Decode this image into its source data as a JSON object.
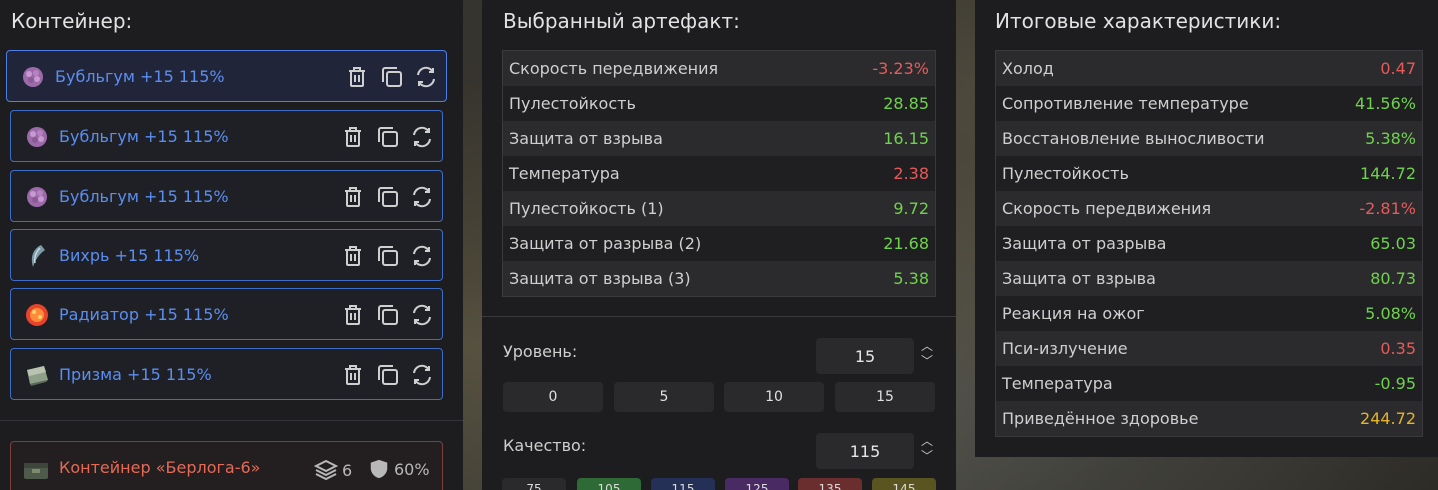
{
  "left": {
    "title": "Контейнер:",
    "items": [
      {
        "name": "Бубльгум +15 115%",
        "icon": "bubblegum-artifact-icon"
      },
      {
        "name": "Бубльгум +15 115%",
        "icon": "bubblegum-artifact-icon"
      },
      {
        "name": "Бубльгум +15 115%",
        "icon": "bubblegum-artifact-icon"
      },
      {
        "name": "Вихрь +15 115%",
        "icon": "vortex-artifact-icon"
      },
      {
        "name": "Радиатор +15 115%",
        "icon": "radiator-artifact-icon"
      },
      {
        "name": "Призма +15 115%",
        "icon": "prism-artifact-icon"
      }
    ],
    "container": {
      "name": "Контейнер «Берлога-6»",
      "slots": "6",
      "protection": "60%"
    }
  },
  "middle": {
    "title": "Выбранный артефакт:",
    "stats": [
      {
        "label": "Скорость передвижения",
        "value": "-3.23%",
        "tone": "neg"
      },
      {
        "label": "Пулестойкость",
        "value": "28.85",
        "tone": "pos"
      },
      {
        "label": "Защита от взрыва",
        "value": "16.15",
        "tone": "pos"
      },
      {
        "label": "Температура",
        "value": "2.38",
        "tone": "neg"
      },
      {
        "label": "Пулестойкость (1)",
        "value": "9.72",
        "tone": "pos"
      },
      {
        "label": "Защита от разрыва (2)",
        "value": "21.68",
        "tone": "pos"
      },
      {
        "label": "Защита от взрыва (3)",
        "value": "5.38",
        "tone": "pos"
      }
    ],
    "level": {
      "label": "Уровень:",
      "value": "15",
      "presets": [
        "0",
        "5",
        "10",
        "15"
      ]
    },
    "quality": {
      "label": "Качество:",
      "value": "115",
      "presets": [
        "75",
        "105",
        "115",
        "125",
        "135",
        "145"
      ]
    }
  },
  "right": {
    "title": "Итоговые характеристики:",
    "stats": [
      {
        "label": "Холод",
        "value": "0.47",
        "tone": "neg"
      },
      {
        "label": "Сопротивление температуре",
        "value": "41.56%",
        "tone": "pos"
      },
      {
        "label": "Восстановление выносливости",
        "value": "5.38%",
        "tone": "pos"
      },
      {
        "label": "Пулестойкость",
        "value": "144.72",
        "tone": "pos"
      },
      {
        "label": "Скорость передвижения",
        "value": "-2.81%",
        "tone": "neg"
      },
      {
        "label": "Защита от разрыва",
        "value": "65.03",
        "tone": "pos"
      },
      {
        "label": "Защита от взрыва",
        "value": "80.73",
        "tone": "pos"
      },
      {
        "label": "Реакция на ожог",
        "value": "5.08%",
        "tone": "pos"
      },
      {
        "label": "Пси-излучение",
        "value": "0.35",
        "tone": "neg"
      },
      {
        "label": "Температура",
        "value": "-0.95",
        "tone": "pos"
      },
      {
        "label": "Приведённое здоровье",
        "value": "244.72",
        "tone": "gold"
      }
    ]
  },
  "colors": {
    "accent": "#5b8ef0",
    "positive": "#6fd24d",
    "negative": "#e65a5a",
    "highlight": "#e6b428"
  }
}
